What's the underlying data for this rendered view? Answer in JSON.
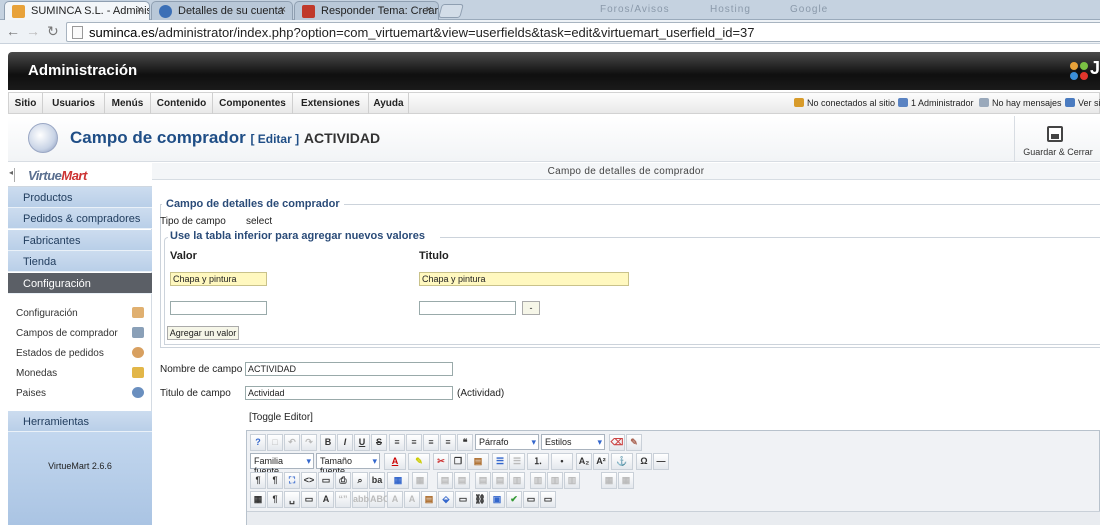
{
  "browser": {
    "tabs": [
      {
        "label": "SUMINCA S.L. - Administr",
        "close": "×",
        "color": "#e8a23a"
      },
      {
        "label": "Detalles de su cuenta",
        "close": "×",
        "color": "#3b6fb6"
      },
      {
        "label": "Responder Tema: Crear un",
        "close": "×",
        "color": "#c0392b"
      }
    ],
    "faded_tabs": [
      "Foros/Avisos",
      "Hosting",
      "Google"
    ],
    "url_domain": "suminca.es",
    "url_path": "/administrator/index.php?option=com_virtuemart&view=userfields&task=edit&virtuemart_userfield_id=37"
  },
  "header": {
    "title": "Administración",
    "logo_text": "J"
  },
  "menu": {
    "items": [
      "Sitio",
      "Usuarios",
      "Menús",
      "Contenido",
      "Componentes",
      "Extensiones",
      "Ayuda"
    ],
    "status": [
      {
        "label": "No conectados al sitio",
        "color": "#d89b2a"
      },
      {
        "label": "1 Administrador",
        "color": "#5a83c2"
      },
      {
        "label": "No hay mensajes",
        "color": "#9aa9bb"
      },
      {
        "label": "Ver si",
        "color": "#4a7bc0"
      }
    ]
  },
  "titlebar": {
    "title": "Campo de comprador",
    "edit": "[ Editar ]",
    "name": "ACTIVIDAD",
    "save_label": "Guardar & Cerrar"
  },
  "sidebar": {
    "logo": {
      "a": "Virtue",
      "b": "Mart"
    },
    "sections": [
      "Productos",
      "Pedidos & compradores",
      "Fabricantes",
      "Tienda",
      "Configuración"
    ],
    "subitems": [
      {
        "label": "Configuración",
        "icon": "tools-icon",
        "color": "#e0b070"
      },
      {
        "label": "Campos de comprador",
        "icon": "form-icon",
        "color": "#8aa0b8"
      },
      {
        "label": "Estados de pedidos",
        "icon": "status-icon",
        "color": "#d8a060"
      },
      {
        "label": "Monedas",
        "icon": "coins-icon",
        "color": "#e2b648"
      },
      {
        "label": "Paises",
        "icon": "globe-icon",
        "color": "#6a8fbf"
      }
    ],
    "tools": "Herramientas",
    "version": "VirtueMart 2.6.6"
  },
  "main": {
    "header": "Campo de detalles de comprador",
    "legend": "Campo de detalles de comprador",
    "field_type_label": "Tipo de campo",
    "field_type_value": "select",
    "inner_legend": "Use la tabla inferior para agregar nuevos valores",
    "col_value": "Valor",
    "col_title": "Titulo",
    "row1_value": "Chapa y pintura",
    "row1_title": "Chapa y pintura",
    "row2_value": "",
    "row2_title": "",
    "remove_btn": "-",
    "add_btn": "Agregar un valor",
    "name_label": "Nombre de campo",
    "name_value": "ACTIVIDAD",
    "title_label": "Titulo de campo",
    "title_value": "Actividad",
    "title_hint": "(Actividad)",
    "toggle": "[Toggle Editor]",
    "editor": {
      "format": "Párrafo",
      "styles": "Estilos",
      "font": "Familia fuente",
      "size": "Tamaño fuente"
    }
  }
}
